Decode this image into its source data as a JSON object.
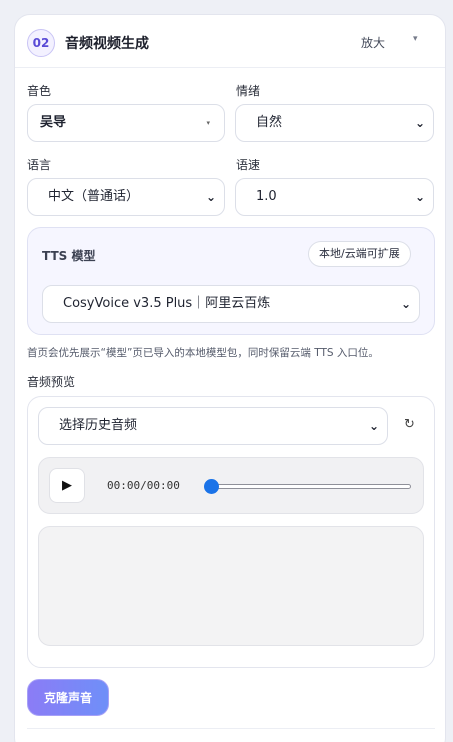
{
  "header": {
    "step": "02",
    "title": "音频视频生成",
    "zoom_label": "放大",
    "collapse_icon": "▾"
  },
  "fields": {
    "voice": {
      "label": "音色",
      "value": "吴导"
    },
    "emotion": {
      "label": "情绪",
      "value": "自然"
    },
    "language": {
      "label": "语言",
      "value": "中文（普通话）"
    },
    "speed": {
      "label": "语速",
      "value": "1.0"
    }
  },
  "tts": {
    "label": "TTS 模型",
    "badge": "本地/云端可扩展",
    "model": "CosyVoice v3.5 Plus｜阿里云百炼"
  },
  "hint": "首页会优先展示“模型”页已导入的本地模型包，同时保留云端 TTS 入口位。",
  "preview": {
    "label": "音频预览",
    "history_select": "选择历史音频",
    "refresh_icon": "↻",
    "play_icon": "▶",
    "time": "00:00/00:00",
    "progress": 0
  },
  "clone_button": "克隆声音",
  "icons": {
    "chevron": "⌄",
    "small_caret": "▾"
  },
  "colors": {
    "accent": "#5a4bd6",
    "clone_gradient_start": "#8b7cf6",
    "clone_gradient_end": "#6f8ff8",
    "slider_thumb": "#1a73e8"
  }
}
